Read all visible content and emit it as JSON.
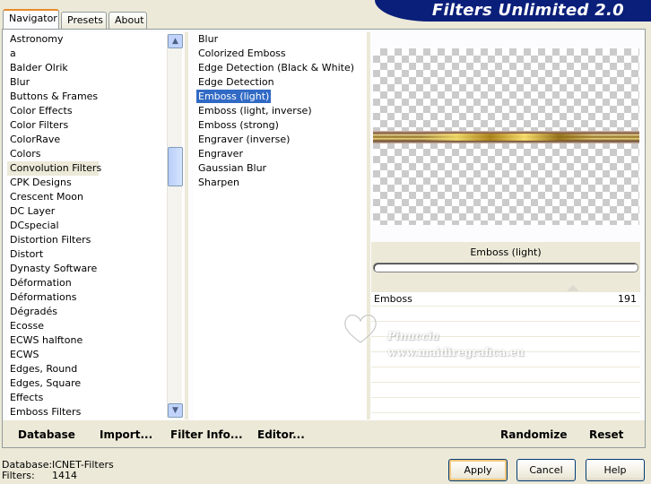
{
  "tabs": [
    {
      "label": "Navigator"
    },
    {
      "label": "Presets"
    },
    {
      "label": "About"
    }
  ],
  "banner": {
    "title": "Filters Unlimited 2.0"
  },
  "categories": [
    "Astronomy",
    "a",
    "Balder Olrik",
    "Blur",
    "Buttons & Frames",
    "Color Effects",
    "Color Filters",
    "ColorRave",
    "Colors",
    "Convolution Filters",
    "CPK Designs",
    "Crescent Moon",
    "DC Layer",
    "DCspecial",
    "Distortion Filters",
    "Distort",
    "Dynasty Software",
    "Déformation",
    "Déformations",
    "Dégradés",
    "Ecosse",
    "ECWS halftone",
    "ECWS",
    "Edges, Round",
    "Edges, Square",
    "Effects",
    "Emboss Filters"
  ],
  "selected_category": "Convolution Filters",
  "filters": [
    "Blur",
    "Colorized Emboss",
    "Edge Detection (Black & White)",
    "Edge Detection",
    "Emboss (light)",
    "Emboss (light, inverse)",
    "Emboss (strong)",
    "Engraver (inverse)",
    "Engraver",
    "Gaussian Blur",
    "Sharpen"
  ],
  "selected_filter": "Emboss (light)",
  "preview": {
    "filter_name": "Emboss (light)"
  },
  "controls": [
    {
      "label": "Emboss",
      "value": "191"
    }
  ],
  "watermark": {
    "name": "Pinuccia",
    "url": "www.maidiregrafica.eu"
  },
  "actions": {
    "database": "Database",
    "import": "Import...",
    "filter_info": "Filter Info...",
    "editor": "Editor...",
    "randomize": "Randomize",
    "reset": "Reset"
  },
  "status": {
    "database_label": "Database:",
    "database_value": "ICNET-Filters",
    "filters_label": "Filters:",
    "filters_value": "1414"
  },
  "buttons": {
    "apply": "Apply",
    "cancel": "Cancel",
    "help": "Help"
  },
  "colors": {
    "banner": "#0a1f7a",
    "selection": "#316ac5",
    "dialog_bg": "#ece9d8"
  }
}
